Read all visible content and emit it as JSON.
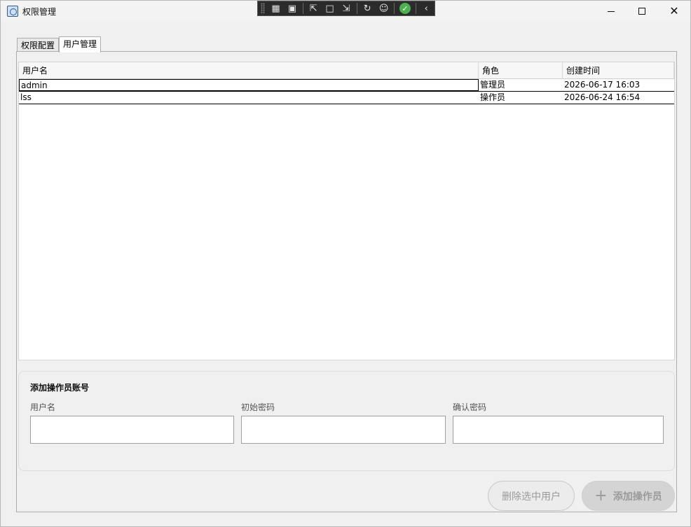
{
  "window": {
    "title": "权限管理"
  },
  "debug_toolbar": {
    "icons": [
      "live-tree-icon",
      "record-icon",
      "select-element-icon",
      "layout-adorner-icon",
      "track-focus-icon",
      "hot-reload-icon",
      "accessibility-icon",
      "binding-ok-icon",
      "collapse-icon"
    ]
  },
  "tabs": [
    {
      "label": "权限配置",
      "active": false
    },
    {
      "label": "用户管理",
      "active": true
    }
  ],
  "table": {
    "columns": [
      "用户名",
      "角色",
      "创建时间"
    ],
    "rows": [
      {
        "username": "admin",
        "role": "管理员",
        "created": "2026-06-17 16:03"
      },
      {
        "username": "lss",
        "role": "操作员",
        "created": "2026-06-24 16:54"
      }
    ]
  },
  "add_form": {
    "title": "添加操作员账号",
    "username_label": "用户名",
    "password_label": "初始密码",
    "confirm_label": "确认密码"
  },
  "buttons": {
    "delete_label": "删除选中用户",
    "add_label": "添加操作员"
  }
}
